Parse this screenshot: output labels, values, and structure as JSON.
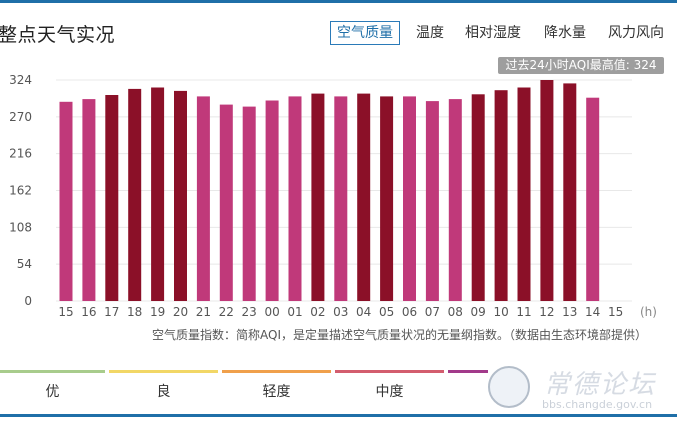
{
  "header": {
    "title": "整点天气实况",
    "tabs": [
      {
        "label": "空气质量",
        "active": true
      },
      {
        "label": "温度",
        "active": false
      },
      {
        "label": "相对湿度",
        "active": false
      },
      {
        "label": "降水量",
        "active": false
      },
      {
        "label": "风力风向",
        "active": false
      }
    ]
  },
  "badge": {
    "text": "过去24小时AQI最高值: 324"
  },
  "note": "空气质量指数：简称AQI，是定量描述空气质量状况的无量纲指数。（数据由生态环境部提供）",
  "legend": [
    {
      "label": "优",
      "color": "#a8cc8c"
    },
    {
      "label": "良",
      "color": "#f2d766"
    },
    {
      "label": "轻度",
      "color": "#f0a04b"
    },
    {
      "label": "中度",
      "color": "#d35d6e"
    },
    {
      "label": "",
      "color": "#a23a8a"
    }
  ],
  "watermark": {
    "text": "常德论坛",
    "url": "bbs.changde.gov.cn"
  },
  "colors": {
    "accent": "#1f6fa8",
    "moderate_bar": "#c0397a",
    "heavy_bar": "#8b1028"
  },
  "chart_data": {
    "type": "bar",
    "categories": [
      "15",
      "16",
      "17",
      "18",
      "19",
      "20",
      "21",
      "22",
      "23",
      "00",
      "01",
      "02",
      "03",
      "04",
      "05",
      "06",
      "07",
      "08",
      "09",
      "10",
      "11",
      "12",
      "13",
      "14",
      "15"
    ],
    "values": [
      292,
      296,
      302,
      311,
      313,
      308,
      300,
      288,
      285,
      294,
      300,
      304,
      300,
      304,
      300,
      300,
      293,
      296,
      303,
      309,
      313,
      324,
      319,
      298,
      null
    ],
    "bar_levels": [
      "moderate",
      "moderate",
      "heavy",
      "heavy",
      "heavy",
      "heavy",
      "moderate",
      "moderate",
      "moderate",
      "moderate",
      "moderate",
      "heavy",
      "moderate",
      "heavy",
      "heavy",
      "moderate",
      "moderate",
      "moderate",
      "heavy",
      "heavy",
      "heavy",
      "heavy",
      "heavy",
      "moderate",
      null
    ],
    "x_unit": "(h)",
    "yticks": [
      0,
      54,
      108,
      162,
      216,
      270,
      324
    ],
    "ylim": [
      0,
      324
    ],
    "grid": true
  }
}
